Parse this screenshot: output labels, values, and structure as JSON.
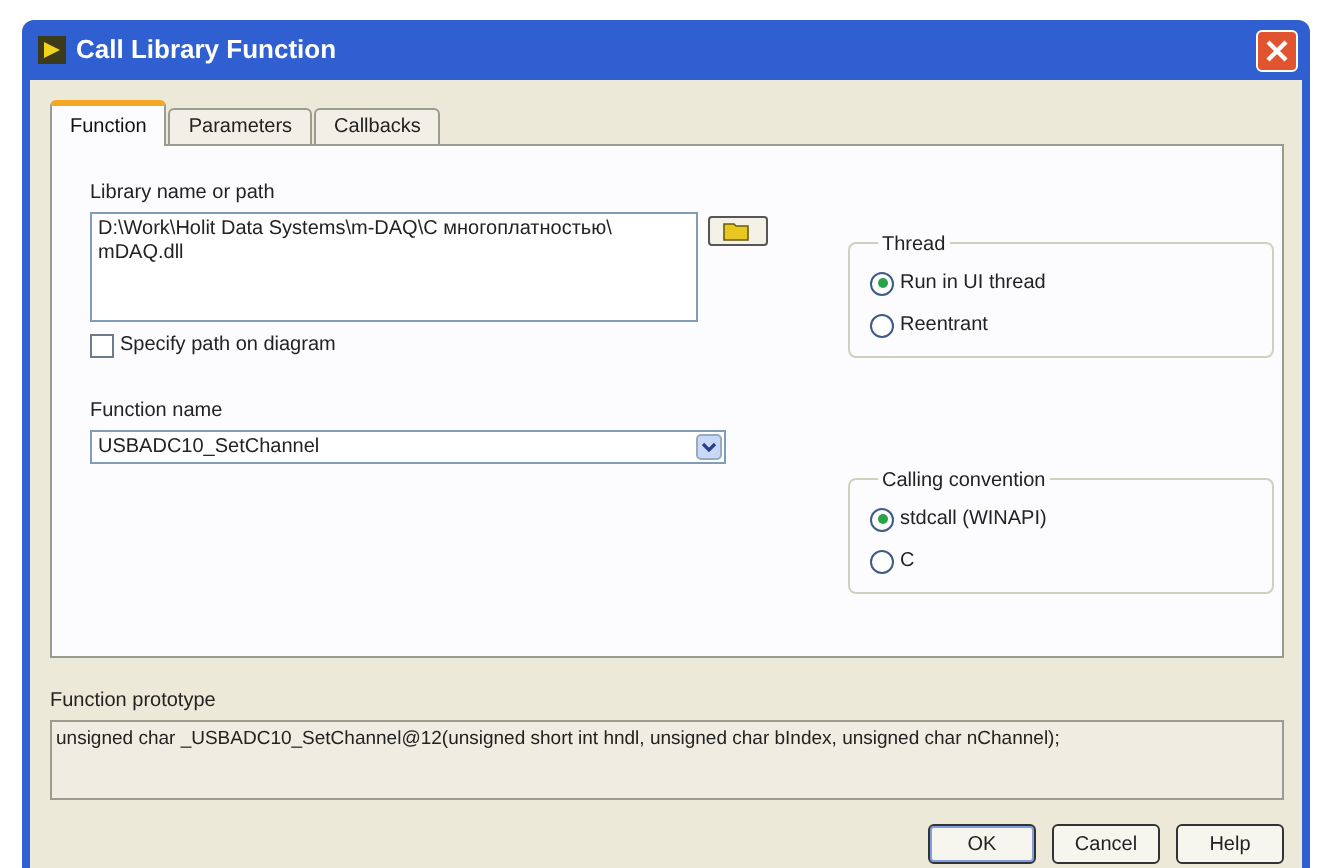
{
  "window": {
    "title": "Call Library Function"
  },
  "tabs": [
    {
      "label": "Function",
      "selected": true
    },
    {
      "label": "Parameters",
      "selected": false
    },
    {
      "label": "Callbacks",
      "selected": false
    }
  ],
  "library": {
    "label": "Library name or path",
    "value_lines": [
      "D:\\Work\\Holit Data Systems\\m-DAQ\\С многоплатностью\\",
      "mDAQ.dll"
    ]
  },
  "specify_path": {
    "label": "Specify path on diagram",
    "checked": false
  },
  "function_name": {
    "label": "Function name",
    "value": "USBADC10_SetChannel"
  },
  "thread": {
    "title": "Thread",
    "options": [
      {
        "label": "Run in UI thread",
        "selected": true
      },
      {
        "label": "Reentrant",
        "selected": false
      }
    ]
  },
  "calling_convention": {
    "title": "Calling convention",
    "options": [
      {
        "label": "stdcall (WINAPI)",
        "selected": true
      },
      {
        "label": "C",
        "selected": false
      }
    ]
  },
  "prototype": {
    "label": "Function prototype",
    "value": "unsigned char _USBADC10_SetChannel@12(unsigned short int hndl, unsigned char bIndex, unsigned char nChannel);"
  },
  "buttons": [
    "OK",
    "Cancel",
    "Help"
  ]
}
